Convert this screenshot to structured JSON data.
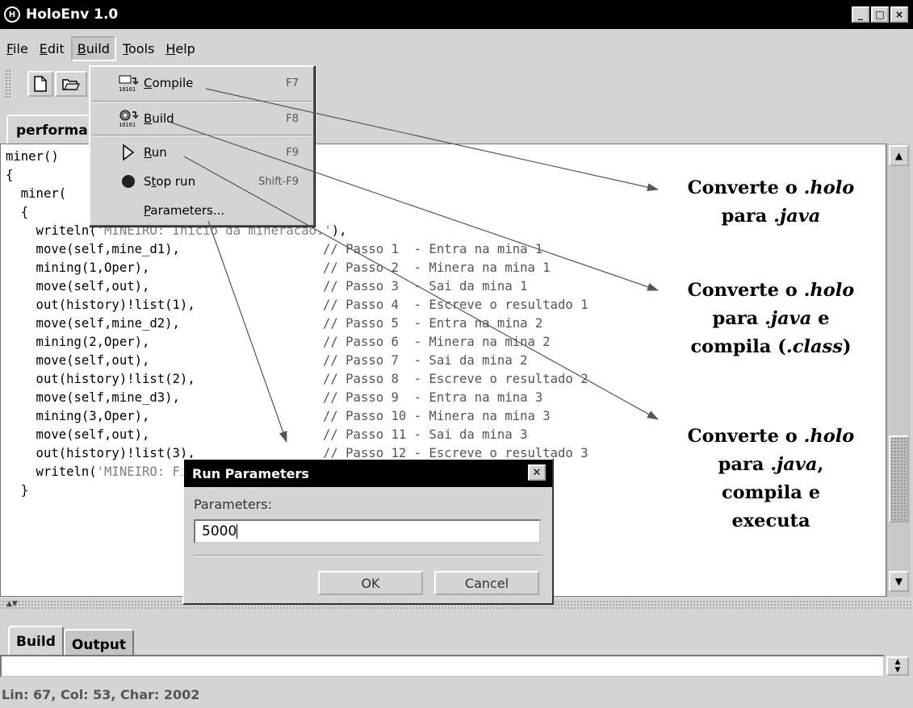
{
  "window": {
    "title": "HoloEnv 1.0",
    "controls": [
      "_",
      "□",
      "×"
    ]
  },
  "menubar": {
    "items": [
      {
        "label": "File",
        "mnemonic": "F",
        "rest": "ile"
      },
      {
        "label": "Edit",
        "mnemonic": "E",
        "rest": "dit"
      },
      {
        "label": "Build",
        "mnemonic": "B",
        "rest": "uild"
      },
      {
        "label": "Tools",
        "mnemonic": "T",
        "rest": "ools"
      },
      {
        "label": "Help",
        "mnemonic": "H",
        "rest": "elp"
      }
    ],
    "open_menu": "Build"
  },
  "toolbar": {
    "buttons": [
      "new-file-icon",
      "open-folder-icon"
    ]
  },
  "build_menu": {
    "items": [
      {
        "label": "Compile",
        "mnemonic": "C",
        "rest": "ompile",
        "shortcut": "F7",
        "icon": "compile-icon"
      },
      {
        "label": "Build",
        "mnemonic": "B",
        "rest": "uild",
        "shortcut": "F8",
        "icon": "build-icon"
      },
      {
        "label": "Run",
        "mnemonic": "R",
        "rest": "un",
        "shortcut": "F9",
        "icon": "run-icon"
      },
      {
        "label": "Stop run",
        "mnemonic": "t",
        "pre": "S",
        "rest": "op run",
        "shortcut": "Shift-F9",
        "icon": "stop-icon"
      },
      {
        "label": "Parameters...",
        "mnemonic": "P",
        "rest": "arameters...",
        "shortcut": "",
        "icon": ""
      }
    ]
  },
  "editor": {
    "tab_label": "performa",
    "lines": [
      {
        "code": "miner()",
        "comment": ""
      },
      {
        "code": "{",
        "comment": ""
      },
      {
        "code": "  miner(",
        "comment": ""
      },
      {
        "code": "  {",
        "comment": ""
      },
      {
        "code": "    writeln(",
        "str": "'MINEIRO: Inicio da mineracao.'",
        "after": "),",
        "comment": ""
      },
      {
        "code": "    move(self,mine_d1),",
        "comment": "// Passo 1  - Entra na mina 1"
      },
      {
        "code": "    mining(1,Oper),",
        "comment": "// Passo 2  - Minera na mina 1"
      },
      {
        "code": "    move(self,out),",
        "comment": "// Passo 3  - Sai da mina 1"
      },
      {
        "code": "    out(history)!list(1),",
        "comment": "// Passo 4  - Escreve o resultado 1"
      },
      {
        "code": "    move(self,mine_d2),",
        "comment": "// Passo 5  - Entra na mina 2"
      },
      {
        "code": "    mining(2,Oper),",
        "comment": "// Passo 6  - Minera na mina 2"
      },
      {
        "code": "    move(self,out),",
        "comment": "// Passo 7  - Sai da mina 2"
      },
      {
        "code": "    out(history)!list(2),",
        "comment": "// Passo 8  - Escreve o resultado 2"
      },
      {
        "code": "    move(self,mine_d3),",
        "comment": "// Passo 9  - Entra na mina 3"
      },
      {
        "code": "    mining(3,Oper),",
        "comment": "// Passo 10 - Minera na mina 3"
      },
      {
        "code": "    move(self,out),",
        "comment": "// Passo 11 - Sai da mina 3"
      },
      {
        "code": "    out(history)!list(3),",
        "comment": "// Passo 12 - Escreve o resultado 3"
      },
      {
        "code": "    writeln(",
        "str": "'MINEIRO: Fim da mineracao.'",
        "after": ")",
        "comment": ""
      },
      {
        "code": "  }",
        "comment": ""
      }
    ]
  },
  "bottom_tabs": [
    {
      "label": "Build"
    },
    {
      "label": "Output"
    }
  ],
  "status": {
    "text": "Lin: 67, Col: 53, Char: 2002"
  },
  "annotations": [
    {
      "lines": [
        [
          "Converte o ",
          ".holo",
          ""
        ],
        [
          "para ",
          ".java",
          ""
        ]
      ]
    },
    {
      "lines": [
        [
          "Converte o ",
          ".holo",
          ""
        ],
        [
          "para ",
          ".java",
          " e"
        ],
        [
          "compila (",
          ".class",
          ")"
        ]
      ]
    },
    {
      "lines": [
        [
          "Converte o ",
          ".holo",
          ""
        ],
        [
          "para ",
          ".java",
          ","
        ],
        [
          "compila e",
          "",
          ""
        ],
        [
          "executa",
          "",
          ""
        ]
      ]
    }
  ],
  "dialog": {
    "title": "Run Parameters",
    "field_label": "Parameters:",
    "field_value": "5000",
    "ok_label": "OK",
    "cancel_label": "Cancel"
  }
}
